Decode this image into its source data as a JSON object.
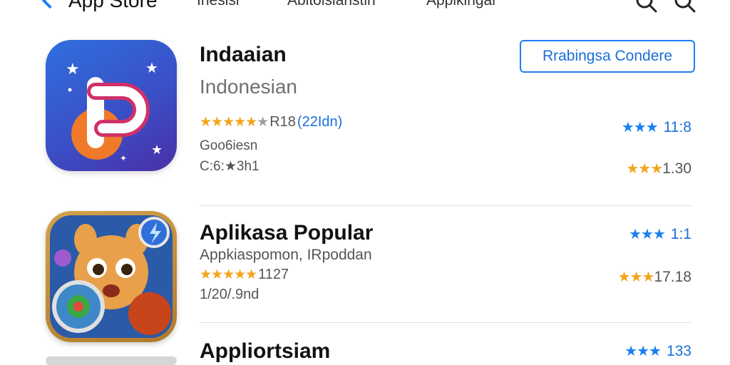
{
  "nav": {
    "back_label": "App Store",
    "tabs": [
      "Inesisi",
      "Abitolsianstin",
      "Appikingai"
    ],
    "icons": [
      "search-icon",
      "search-icon"
    ]
  },
  "apps": [
    {
      "title": "Indaaian",
      "subtitle": "Indonesian",
      "rating_stars": "★★★★★",
      "rating_dim_star": "★",
      "rating_prefix": "R18",
      "rating_count": "(22Idn)",
      "meta1": "Goo6iesn",
      "meta2": "C:6:★3h1",
      "action_label": "Rrabingsa Condere",
      "right_top": {
        "stars": "★★★",
        "value": "11:8"
      },
      "right_bottom": {
        "stars": "★★★",
        "value": "1.30"
      }
    },
    {
      "title": "Aplikasa Popular",
      "subtitle": "Appkiaspomon, IRpoddan",
      "rating_stars": "★★★★★",
      "rating_text": "1127",
      "meta1": "1/20/.9nd",
      "right_top": {
        "stars": "★★★",
        "value": "1:1"
      },
      "right_bottom": {
        "stars": "★★★",
        "value": "17.18"
      }
    },
    {
      "title": "Appliortsiam",
      "right_top": {
        "stars": "★★★",
        "value": "133"
      }
    }
  ],
  "colors": {
    "accent": "#1a7ff0",
    "star_gold": "#f2a51a",
    "icon1_bg": "#3a50c6",
    "icon2_bg": "#c08a36"
  }
}
